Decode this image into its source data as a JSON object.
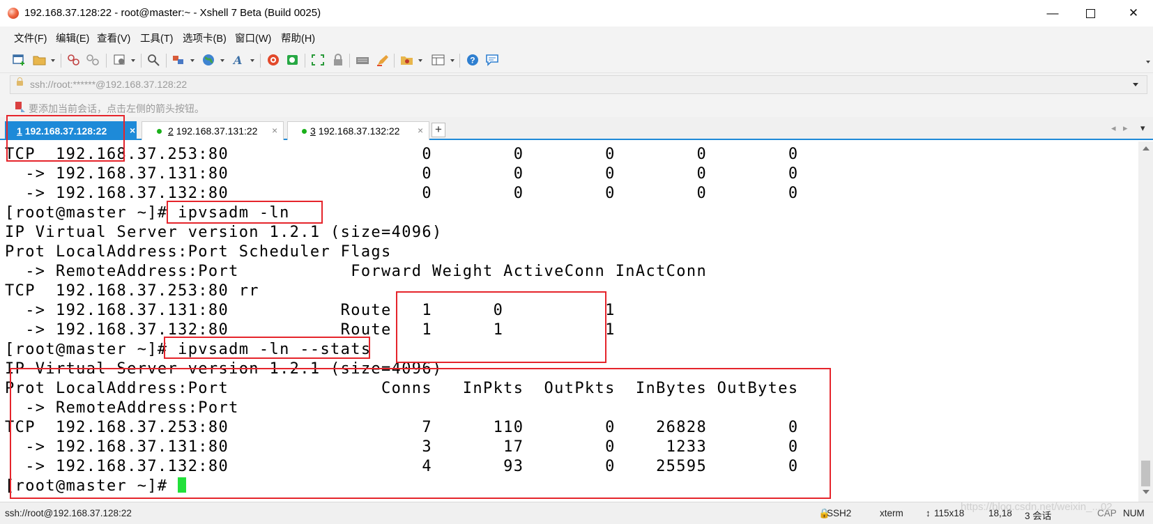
{
  "window": {
    "title": "192.168.37.128:22 - root@master:~ - Xshell 7 Beta (Build 0025)",
    "min_symbol": "—",
    "close_symbol": "✕"
  },
  "menu": [
    "文件(F)",
    "编辑(E)",
    "查看(V)",
    "工具(T)",
    "选项卡(B)",
    "窗口(W)",
    "帮助(H)"
  ],
  "toolbar": {
    "icons": [
      "new-session-icon",
      "open-folder-icon",
      "connect-icon",
      "disconnect-icon",
      "properties-icon",
      "find-icon",
      "transfer-icon",
      "globe-icon",
      "font-icon",
      "xshell-icon",
      "xftp-icon",
      "fullscreen-icon",
      "lock-icon",
      "keyboard-icon",
      "highlight-icon",
      "script-icon",
      "layout-icon",
      "help-icon",
      "chat-icon"
    ]
  },
  "address": {
    "value": "ssh://root:******@192.168.37.128:22"
  },
  "hint": {
    "text": "要添加当前会话，点击左侧的箭头按钮。"
  },
  "tabs": [
    {
      "num": "1",
      "label": "192.168.37.128:22",
      "active": true
    },
    {
      "num": "2",
      "label": "192.168.37.131:22",
      "active": false
    },
    {
      "num": "3",
      "label": "192.168.37.132:22",
      "active": false
    }
  ],
  "tab_close": "×",
  "tab_add": "+",
  "terminal": {
    "lines": [
      "TCP  192.168.37.253:80                   0        0        0        0        0",
      "  -> 192.168.37.131:80                   0        0        0        0        0",
      "  -> 192.168.37.132:80                   0        0        0        0        0",
      "[root@master ~]# ipvsadm -ln",
      "IP Virtual Server version 1.2.1 (size=4096)",
      "Prot LocalAddress:Port Scheduler Flags",
      "  -> RemoteAddress:Port           Forward Weight ActiveConn InActConn",
      "TCP  192.168.37.253:80 rr",
      "  -> 192.168.37.131:80           Route   1      0          1",
      "  -> 192.168.37.132:80           Route   1      1          1",
      "[root@master ~]# ipvsadm -ln --stats",
      "IP Virtual Server version 1.2.1 (size=4096)",
      "Prot LocalAddress:Port               Conns   InPkts  OutPkts  InBytes OutBytes",
      "  -> RemoteAddress:Port",
      "TCP  192.168.37.253:80                   7      110        0    26828        0",
      "  -> 192.168.37.131:80                   3       17        0     1233        0",
      "  -> 192.168.37.132:80                   4       93        0    25595        0"
    ],
    "prompt": "[root@master ~]# "
  },
  "status": {
    "left": "ssh://root@192.168.37.128:22",
    "protocol": "SSH2",
    "term": "xterm",
    "size": "115x18",
    "pos": "18,18",
    "sessions": "3 会话",
    "cap": "CAP",
    "num": "NUM"
  },
  "watermark": "https://blog.csdn.net/weixin_...02",
  "colors": {
    "accent": "#1e8ad8",
    "annotation": "#e5242b",
    "cursor": "#22e03a",
    "active_dot": "#1ab01a"
  }
}
